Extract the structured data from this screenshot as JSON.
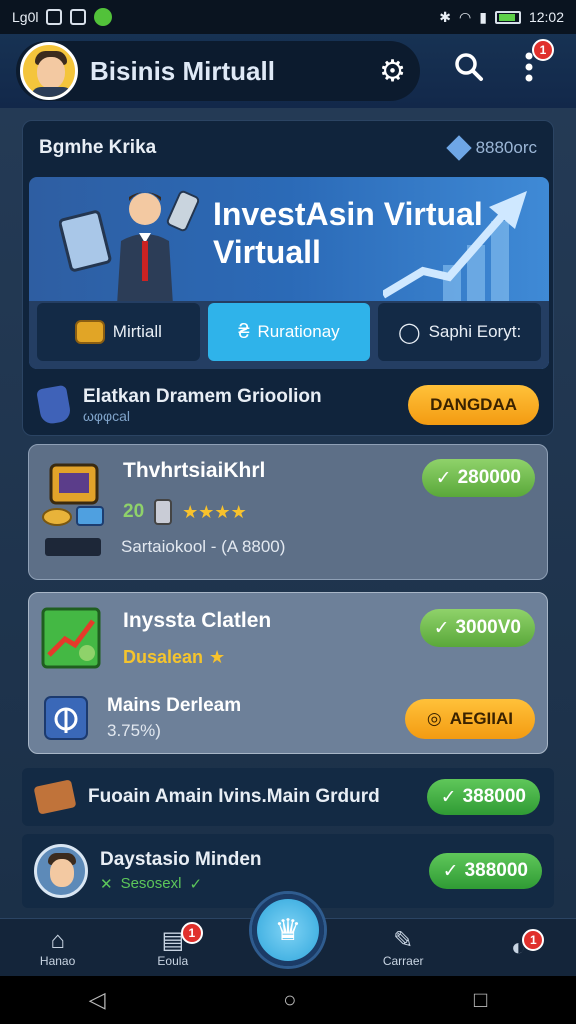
{
  "statusbar": {
    "carrier": "Lg0l",
    "time": "12:02"
  },
  "appbar": {
    "title": "Bisinis Mirtuall",
    "menu_badge": "1"
  },
  "summary": {
    "label": "Bgmhe Krika",
    "balance": "8880orc"
  },
  "banner": {
    "title_line1": "InvestAsin Virtual",
    "title_line2": "Virtuall"
  },
  "tabs": [
    {
      "label": "Mirtiall",
      "icon": "coin-icon"
    },
    {
      "label": "Rurationay",
      "icon": "currency-icon"
    },
    {
      "label": "Saphi Eoryt:",
      "icon": "ring-icon"
    }
  ],
  "promo": {
    "title": "Elatkan Dramem Grioolion",
    "subtitle": "ωφφcal",
    "button": "DANGDAA"
  },
  "list": [
    {
      "title": "ThvhrtsiaiKhrl",
      "price": "280000",
      "level": "20",
      "rating": 4,
      "meta": "Sartaiokool - (A 8800)"
    },
    {
      "title": "Inyssta Clatlen",
      "price": "3000V0",
      "tag": "Dusalean",
      "sub_title": "Mains Derleam",
      "sub_value": "3.75%)",
      "button": "AEGIIAI"
    }
  ],
  "row4": {
    "title": "Fuoain Amain Ivins.Main Grdurd",
    "price": "388000"
  },
  "row5": {
    "title": "Daystasio Minden",
    "sub": "Sesosexl",
    "price": "388000"
  },
  "bottom_nav": [
    {
      "label": "Hanao",
      "badge": ""
    },
    {
      "label": "Eoula",
      "badge": "1"
    },
    {
      "label": "Carraer",
      "badge": ""
    },
    {
      "label": "",
      "badge": "1"
    }
  ],
  "colors": {
    "accent": "#2fb3ea",
    "orange": "#f39b12",
    "green": "#5aa83a"
  }
}
